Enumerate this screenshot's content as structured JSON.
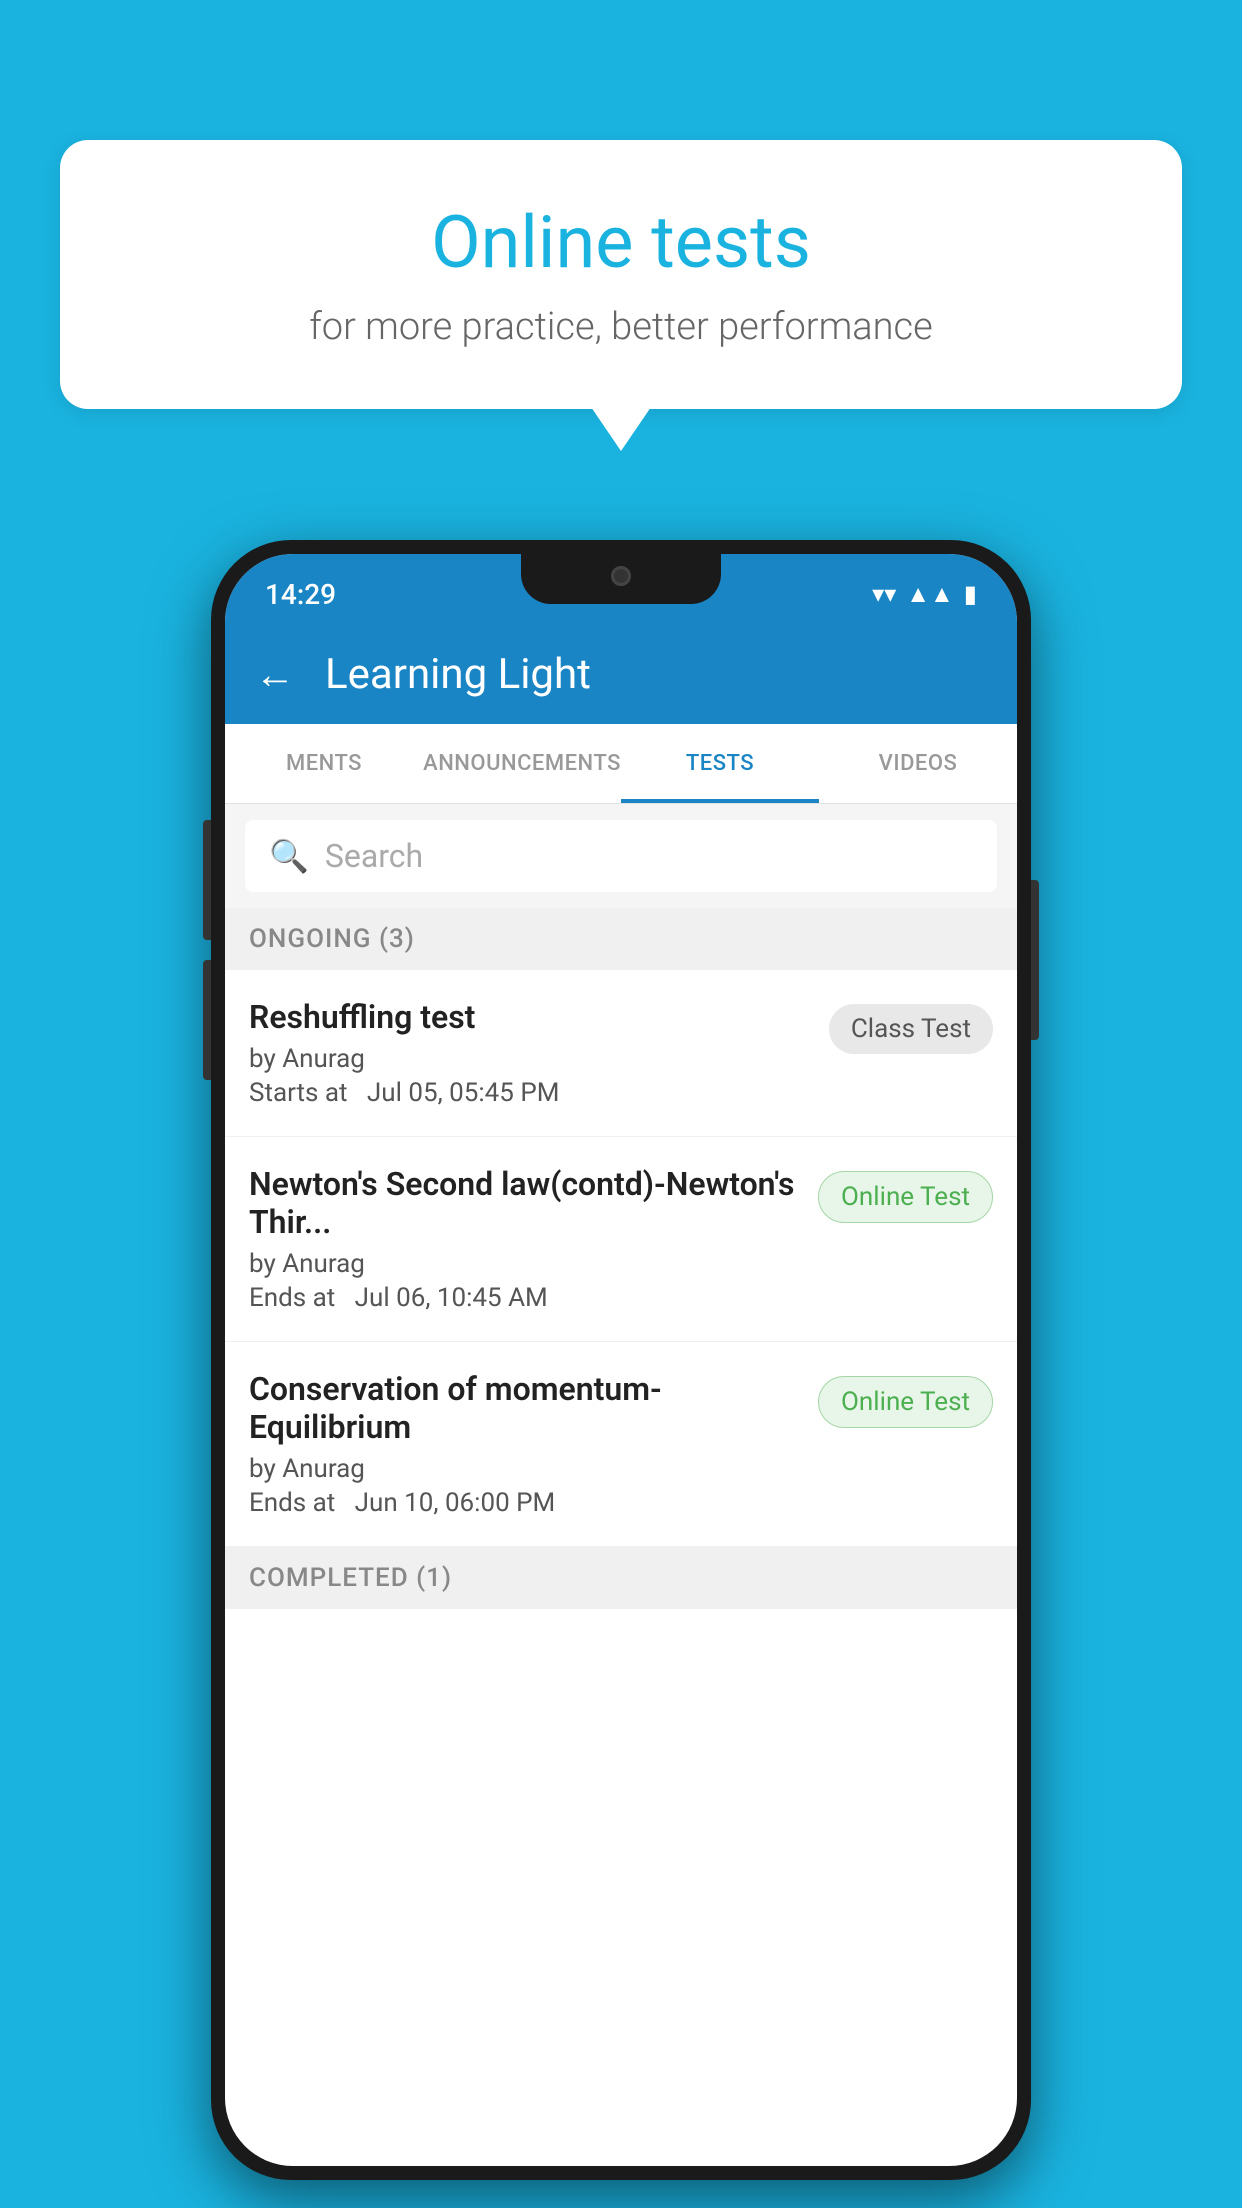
{
  "background_color": "#1ab3e0",
  "speech_bubble": {
    "title": "Online tests",
    "subtitle": "for more practice, better performance"
  },
  "phone": {
    "status_bar": {
      "time": "14:29",
      "icons": [
        "wifi",
        "signal",
        "battery"
      ]
    },
    "header": {
      "title": "Learning Light",
      "back_label": "←"
    },
    "tabs": [
      {
        "label": "MENTS",
        "active": false
      },
      {
        "label": "ANNOUNCEMENTS",
        "active": false
      },
      {
        "label": "TESTS",
        "active": true
      },
      {
        "label": "VIDEOS",
        "active": false
      }
    ],
    "search": {
      "placeholder": "Search"
    },
    "sections": [
      {
        "header": "ONGOING (3)",
        "tests": [
          {
            "name": "Reshuffling test",
            "author": "by Anurag",
            "date": "Starts at  Jul 05, 05:45 PM",
            "badge": "Class Test",
            "badge_type": "class"
          },
          {
            "name": "Newton's Second law(contd)-Newton's Thir...",
            "author": "by Anurag",
            "date": "Ends at  Jul 06, 10:45 AM",
            "badge": "Online Test",
            "badge_type": "online"
          },
          {
            "name": "Conservation of momentum-Equilibrium",
            "author": "by Anurag",
            "date": "Ends at  Jun 10, 06:00 PM",
            "badge": "Online Test",
            "badge_type": "online"
          }
        ]
      },
      {
        "header": "COMPLETED (1)",
        "tests": []
      }
    ]
  }
}
